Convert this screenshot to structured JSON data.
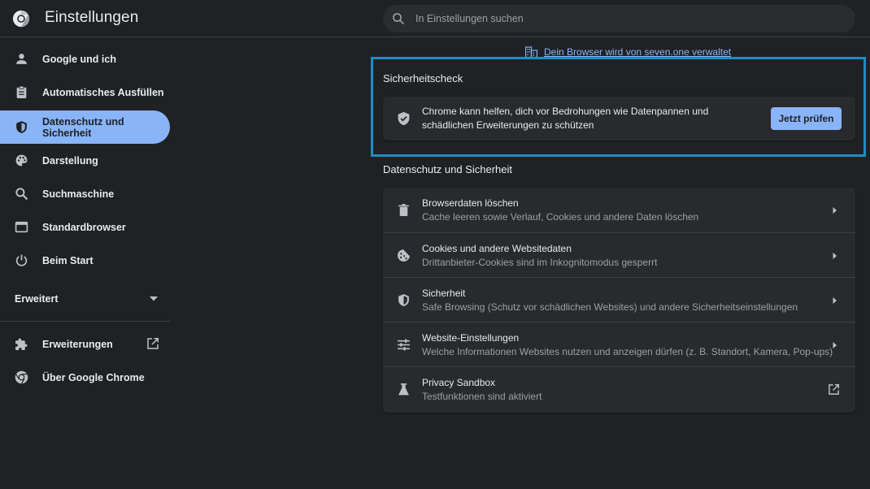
{
  "header": {
    "title": "Einstellungen",
    "search_placeholder": "In Einstellungen suchen"
  },
  "sidebar": {
    "items": [
      {
        "label": "Google und ich",
        "icon": "person-icon"
      },
      {
        "label": "Automatisches Ausfüllen",
        "icon": "clipboard-icon"
      },
      {
        "label": "Datenschutz und Sicherheit",
        "icon": "shield-icon",
        "active": true
      },
      {
        "label": "Darstellung",
        "icon": "palette-icon"
      },
      {
        "label": "Suchmaschine",
        "icon": "search-icon"
      },
      {
        "label": "Standardbrowser",
        "icon": "browser-window-icon"
      },
      {
        "label": "Beim Start",
        "icon": "power-icon"
      }
    ],
    "advanced_label": "Erweitert",
    "extensions_label": "Erweiterungen",
    "about_label": "Über Google Chrome"
  },
  "main": {
    "managed_notice": "Dein Browser wird von seven.one verwaltet",
    "safety_check": {
      "title": "Sicherheitscheck",
      "text": "Chrome kann helfen, dich vor Bedrohungen wie Datenpannen und schädlichen Erweiterungen zu schützen",
      "button_label": "Jetzt prüfen"
    },
    "privacy_section": {
      "title": "Datenschutz und Sicherheit",
      "rows": [
        {
          "title": "Browserdaten löschen",
          "subtitle": "Cache leeren sowie Verlauf, Cookies und andere Daten löschen",
          "icon": "trash-icon"
        },
        {
          "title": "Cookies und andere Websitedaten",
          "subtitle": "Drittanbieter-Cookies sind im Inkognitomodus gesperrt",
          "icon": "cookie-icon"
        },
        {
          "title": "Sicherheit",
          "subtitle": "Safe Browsing (Schutz vor schädlichen Websites) und andere Sicherheitseinstellungen",
          "icon": "security-shield-icon"
        },
        {
          "title": "Website-Einstellungen",
          "subtitle": "Welche Informationen Websites nutzen und anzeigen dürfen (z. B. Standort, Kamera, Pop-ups)",
          "icon": "sliders-icon"
        },
        {
          "title": "Privacy Sandbox",
          "subtitle": "Testfunktionen sind aktiviert",
          "icon": "flask-icon"
        }
      ]
    }
  },
  "colors": {
    "background": "#202124",
    "card": "#292a2d",
    "accent": "#8ab4f8",
    "highlight_frame": "#1a8fc4",
    "text_primary": "#e8eaed",
    "text_secondary": "#9aa0a6"
  }
}
